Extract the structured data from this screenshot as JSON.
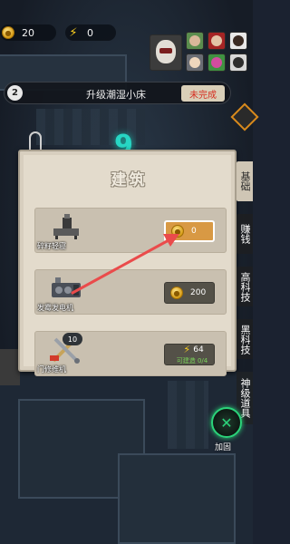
{
  "hud": {
    "coins": "20",
    "energy": "0"
  },
  "task": {
    "index": "2",
    "text": "升级潮湿小床",
    "status": "未完成"
  },
  "level": "9",
  "panel": {
    "title": "建筑",
    "rows": [
      {
        "label": "碎籽轻寝",
        "cost": "0",
        "cost_icon": "coin-icon"
      },
      {
        "label": "发霉发电机",
        "cost": "200",
        "cost_icon": "coin-icon"
      },
      {
        "label": "门修维机",
        "level": "10",
        "cost": "64",
        "cost_icon": "bolt-icon",
        "condition": "可建造 0/4"
      }
    ]
  },
  "tabs": [
    "基础",
    "赚钱",
    "高科技",
    "黑科技",
    "神级道具"
  ],
  "speed_button": "加固",
  "colors": {
    "accent_teal": "#27d6c4",
    "status_red": "#d62d20",
    "highlight_orange": "#d89944",
    "speed_green": "#2bd47a"
  }
}
